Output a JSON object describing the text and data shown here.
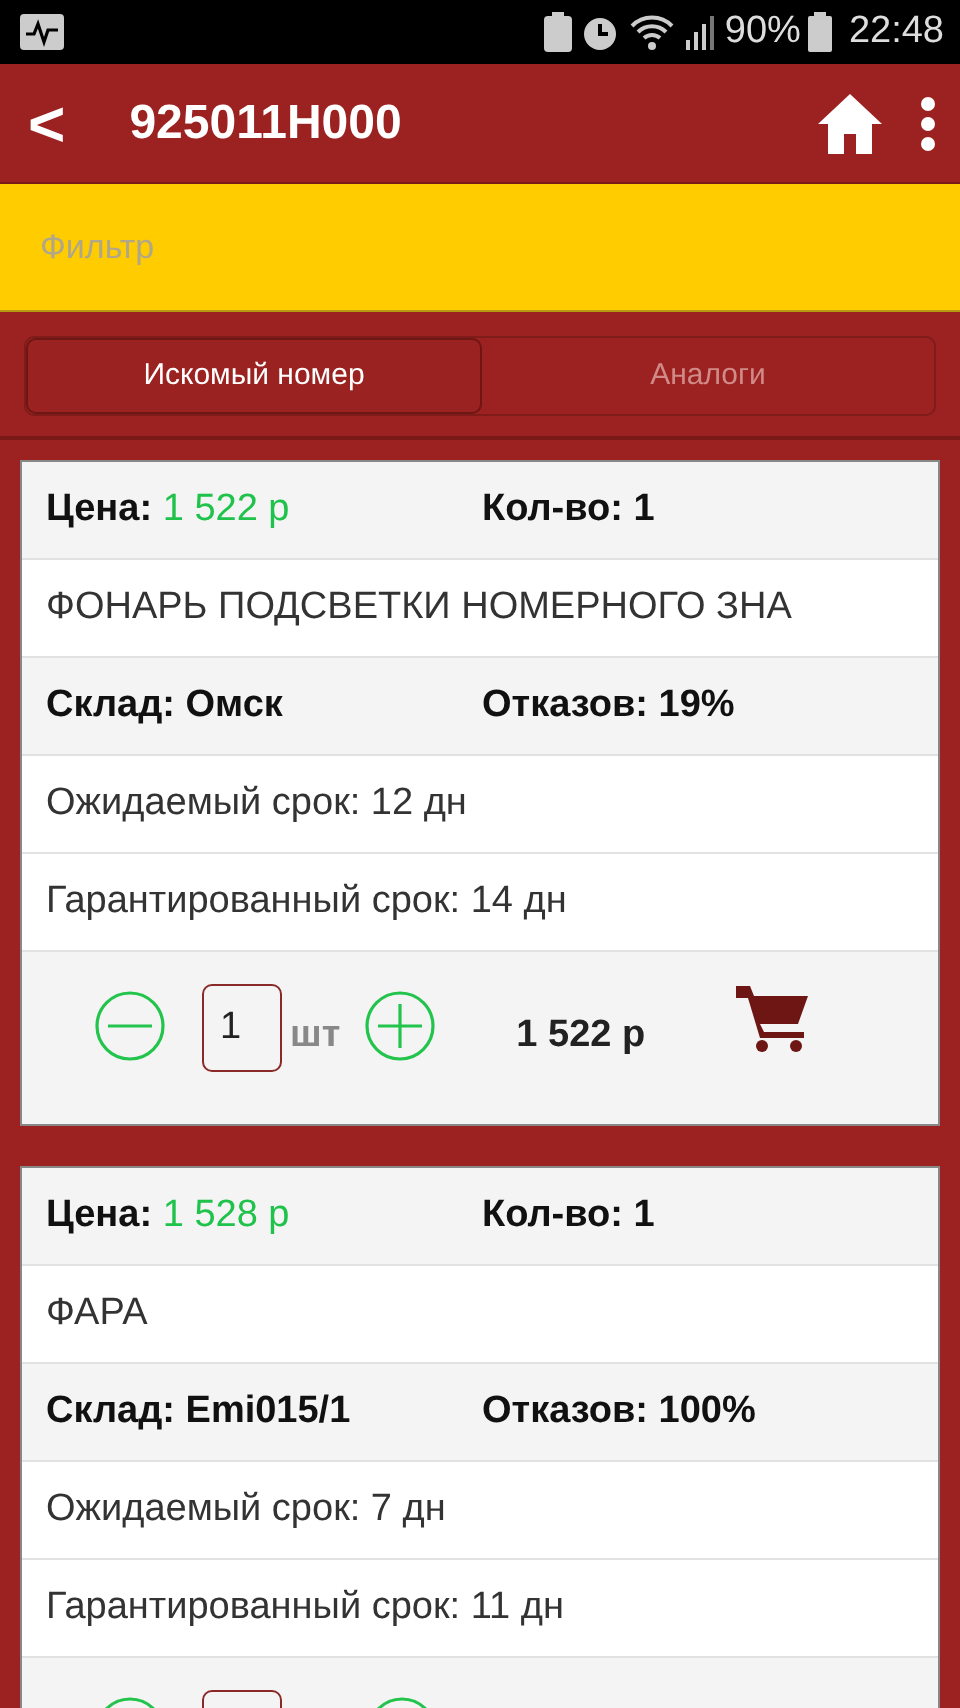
{
  "status_bar": {
    "battery": "90%",
    "time": "22:48"
  },
  "app_bar": {
    "back": "<",
    "title": "925011H000"
  },
  "filter": {
    "placeholder": "Фильтр"
  },
  "tabs": [
    {
      "label": "Искомый номер",
      "selected": true
    },
    {
      "label": "Аналоги",
      "selected": false
    }
  ],
  "offers": [
    {
      "price_label": "Цена:",
      "price": "1 522 р",
      "qty_label": "Кол-во: 1",
      "name": "ФОНАРЬ ПОДСВЕТКИ НОМЕРНОГО ЗНА",
      "warehouse": "Склад: Омск",
      "refusals": "Отказов: 19%",
      "expected": "Ожидаемый срок: 12 дн",
      "guaranteed": "Гарантированный срок: 14 дн",
      "order": {
        "quantity": "1",
        "unit": "шт",
        "total": "1 522 р"
      }
    },
    {
      "price_label": "Цена:",
      "price": "1 528 р",
      "qty_label": "Кол-во: 1",
      "name": "ФАРА",
      "warehouse": "Склад: Emi015/1",
      "refusals": "Отказов: 100%",
      "expected": "Ожидаемый срок: 7 дн",
      "guaranteed": "Гарантированный срок: 11 дн"
    }
  ]
}
